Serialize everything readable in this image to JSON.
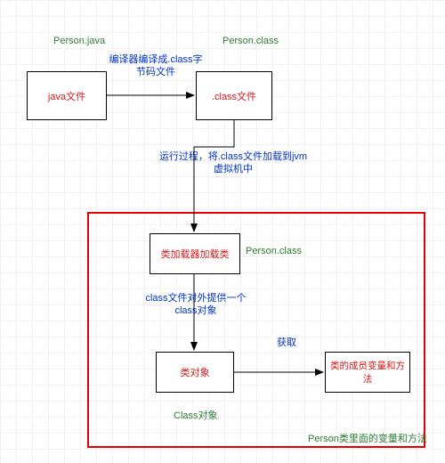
{
  "nodes": {
    "javaFile": {
      "label": "java文件",
      "caption": "Person.java"
    },
    "classFile": {
      "label": ".class文件",
      "caption": "Person.class"
    },
    "loader": {
      "label": "类加载器加载类",
      "caption": "Person.class"
    },
    "classObj": {
      "label": "类对象",
      "caption": "Class对象"
    },
    "members": {
      "label": "类的成员变量和方法",
      "caption": "Person类里面的变量和方法"
    }
  },
  "edges": {
    "a": "编译器编译成.class字节码文件",
    "b": "运行过程，将.class文件加载到jvm虚拟机中",
    "c": "class文件对外提供一个class对象",
    "d": "获取"
  },
  "colors": {
    "nodeText": "#d21919",
    "edgeText": "#0033cc",
    "captionText": "#2e7d32",
    "container": "#e60000"
  }
}
